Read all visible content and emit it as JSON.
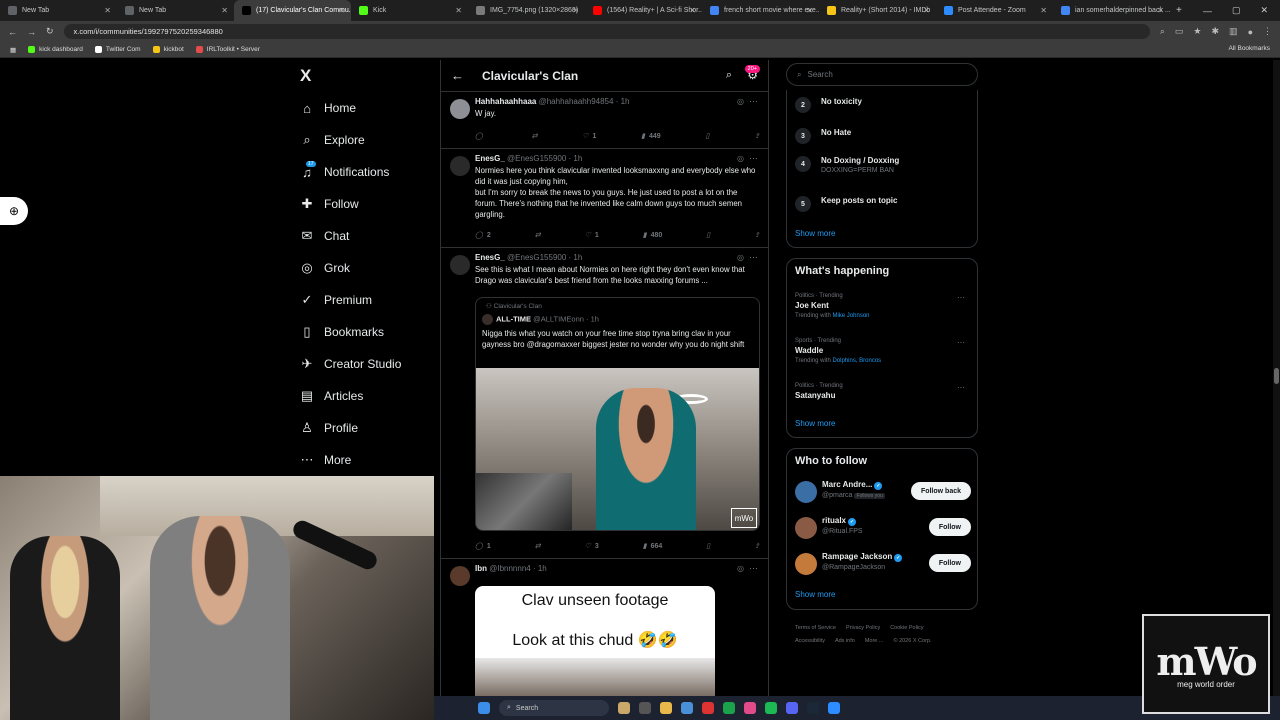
{
  "browser": {
    "tabs": [
      {
        "label": "New Tab",
        "color": "#5f6368"
      },
      {
        "label": "New Tab",
        "color": "#5f6368"
      },
      {
        "label": "(17) Clavicular's Clan Commu...",
        "color": "#000000",
        "active": true
      },
      {
        "label": "Kick",
        "color": "#53fc18"
      },
      {
        "label": "IMG_7754.png (1320×2868)",
        "color": "#7a7a7a"
      },
      {
        "label": "(1564) Reality+ | A Sci-fi Shor...",
        "color": "#ff0000"
      },
      {
        "label": "french short movie where eve...",
        "color": "#4285f4"
      },
      {
        "label": "Reality+ (Short 2014) - IMDb",
        "color": "#f5c518"
      },
      {
        "label": "Post Attendee - Zoom",
        "color": "#2d8cff"
      },
      {
        "label": "ian somerhalderpinned back ...",
        "color": "#4285f4"
      }
    ],
    "url": "x.com/i/communities/1992797520259346880",
    "bookmarks": [
      {
        "label": "kick dashboard",
        "color": "#53fc18"
      },
      {
        "label": "Twitter Com",
        "color": "#ffffff"
      },
      {
        "label": "kickbot",
        "color": "#f5c518"
      },
      {
        "label": "IRLToolkit • Server",
        "color": "#e34c4c"
      }
    ],
    "all_bookmarks": "All Bookmarks"
  },
  "nav": {
    "logo": "X",
    "items": [
      {
        "label": "Home",
        "icon": "⌂"
      },
      {
        "label": "Explore",
        "icon": "⌕"
      },
      {
        "label": "Notifications",
        "icon": "♫"
      },
      {
        "label": "Follow",
        "icon": "✚"
      },
      {
        "label": "Chat",
        "icon": "✉"
      },
      {
        "label": "Grok",
        "icon": "◎"
      },
      {
        "label": "Premium",
        "icon": "✓"
      },
      {
        "label": "Bookmarks",
        "icon": "▯"
      },
      {
        "label": "Creator Studio",
        "icon": "✈"
      },
      {
        "label": "Articles",
        "icon": "▤"
      },
      {
        "label": "Profile",
        "icon": "♙"
      },
      {
        "label": "More",
        "icon": "⋯"
      }
    ],
    "notif_badge": "17"
  },
  "header": {
    "title": "Clavicular's Clan",
    "badge": "20+"
  },
  "posts": [
    {
      "name": "Hahhahaahhaaa",
      "handle": "@hahhahaahh94854 · 1h",
      "body": "W jay.",
      "replies": "",
      "reposts": "",
      "likes": "1",
      "views": "449"
    },
    {
      "name": "EnesG_",
      "handle": "@EnesG155900 · 1h",
      "body": "Normies here you think clavicular invented looksmaxxng and everybody else who did it was just copying him,",
      "body2": "but I'm sorry to break the news to you guys. He just used to post a lot on the forum. There's nothing that he invented like calm down guys too much semen gargling.",
      "replies": "2",
      "reposts": "",
      "likes": "1",
      "views": "480"
    },
    {
      "name": "EnesG_",
      "handle": "@EnesG155900 · 1h",
      "body": "See this is what I mean about Normies on here right they don't even know that Drago was clavicular's best friend from the looks maxxing forums ...",
      "quote": {
        "community": "Clavicular's Clan",
        "name": "ALL-TIME",
        "handle": "@ALLTIMEonn · 1h",
        "body": "Nigga this what you watch on your free time stop tryna bring clav in your gayness bro @dragomaxxer biggest jester no wonder why you do night shift"
      },
      "replies": "1",
      "reposts": "",
      "likes": "3",
      "views": "664"
    },
    {
      "name": "Ibn",
      "handle": "@Ibnnnnn4 · 1h",
      "video_caption1": "Clav unseen footage",
      "video_caption2": "Look at this chud 🤣🤣"
    }
  ],
  "search_placeholder": "Search",
  "rules": [
    {
      "num": "2",
      "label": "No toxicity",
      "sub": ""
    },
    {
      "num": "3",
      "label": "No Hate",
      "sub": ""
    },
    {
      "num": "4",
      "label": "No Doxing / Doxxing",
      "sub": "DOXXING=PERM BAN"
    },
    {
      "num": "5",
      "label": "Keep posts on topic",
      "sub": ""
    }
  ],
  "show_more": "Show more",
  "happening": {
    "title": "What's happening",
    "trends": [
      {
        "meta": "Politics · Trending",
        "title": "Joe Kent",
        "with_prefix": "Trending with",
        "with": "Mike Johnson"
      },
      {
        "meta": "Sports · Trending",
        "title": "Waddle",
        "with_prefix": "Trending with",
        "with": "Dolphins, Broncos"
      },
      {
        "meta": "Politics · Trending",
        "title": "Satanyahu",
        "with_prefix": "",
        "with": ""
      }
    ]
  },
  "who_to_follow": {
    "title": "Who to follow",
    "people": [
      {
        "name": "Marc Andre...",
        "handle": "@pmarca",
        "tag": "Follows you",
        "button": "Follow back",
        "color": "#3a6ea5"
      },
      {
        "name": "ritualx",
        "handle": "@Ritual.FPS",
        "tag": "",
        "button": "Follow",
        "color": "#8a5a44"
      },
      {
        "name": "Rampage Jackson",
        "handle": "@RampageJackson",
        "tag": "",
        "button": "Follow",
        "color": "#c47a3a"
      }
    ]
  },
  "footer": [
    "Terms of Service",
    "Privacy Policy",
    "Cookie Policy",
    "Accessibility",
    "Ads info",
    "More ...",
    "© 2026 X Corp."
  ],
  "taskbar": {
    "search": "Search"
  },
  "overlay": {
    "logo": "mWo",
    "tagline": "meg world order"
  }
}
